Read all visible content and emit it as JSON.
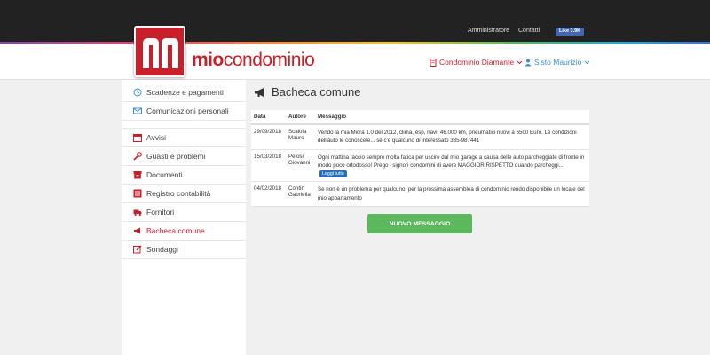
{
  "topbar": {
    "admin_label": "Amministratore",
    "contacts_label": "Contatti",
    "fb_like": "Like 3.9K"
  },
  "brand": {
    "mio": "mio",
    "condominio": "condominio"
  },
  "header": {
    "condo_label": "Condominio Diamante",
    "user_label": "Sisto Maurizio"
  },
  "sidebar": {
    "items": [
      {
        "label": "Scadenze e pagamenti",
        "icon": "clock-icon"
      },
      {
        "label": "Comunicazioni personali",
        "icon": "envelope-icon"
      },
      {
        "label": "Avvisi",
        "icon": "calendar-icon"
      },
      {
        "label": "Guasti e problemi",
        "icon": "wrench-icon"
      },
      {
        "label": "Documenti",
        "icon": "archive-icon"
      },
      {
        "label": "Registro contabilità",
        "icon": "ledger-icon"
      },
      {
        "label": "Fornitori",
        "icon": "truck-icon"
      },
      {
        "label": "Bacheca comune",
        "icon": "megaphone-icon"
      },
      {
        "label": "Sondaggi",
        "icon": "edit-icon"
      }
    ]
  },
  "main": {
    "title": "Bacheca comune",
    "columns": [
      "Data",
      "Autore",
      "Messaggio"
    ],
    "rows": [
      {
        "date": "29/09/2018",
        "author": "Scaiola Mauro",
        "message": "Vendo la mia Micra 1.0 del 2012, clima, esp, navi, 46.000 km, pneumatici nuovi a 6500 Euro. Le condizioni dell'auto le conoscete... se c'è qualcuno di interessato 335-987441"
      },
      {
        "date": "15/03/2018",
        "author": "Pelosi Giovanni",
        "message": "Ogni mattina faccio sempre molta fatica per uscire dal mio garage a causa delle auto parcheggiate di fronte in modo poco ortodosso! Prego i signori condomini di avere MAGGIOR RISPETTO quando parcheggi...",
        "read_more": "Leggi tutto"
      },
      {
        "date": "04/02/2018",
        "author": "Contin Gabriella",
        "message": "Se non è un problema per qualcuno, per la prossima assemblea di condominio rendo disponibile un locale del mio appartamento"
      }
    ],
    "new_button": "NUOVO MESSAGGIO"
  },
  "colors": {
    "brand_red": "#c91f2b",
    "user_blue": "#3a8fd4",
    "button_green": "#5cb85c"
  }
}
